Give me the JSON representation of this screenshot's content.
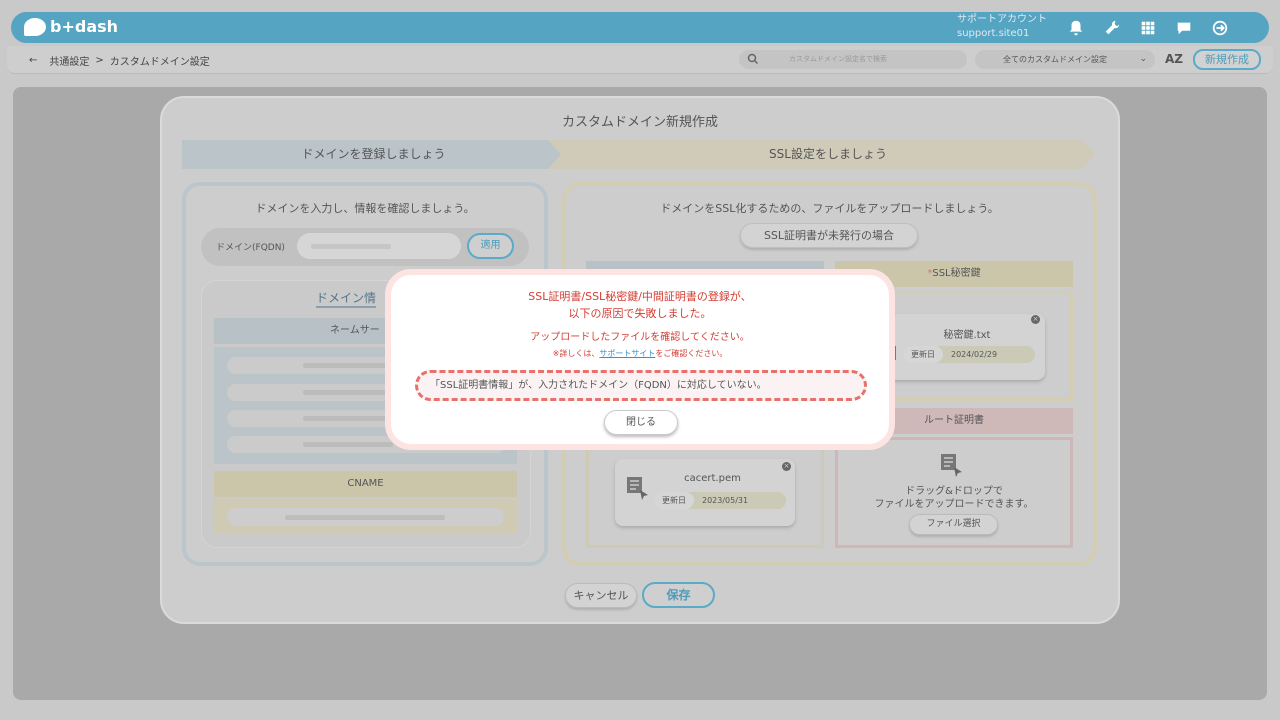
{
  "header": {
    "brand": "b+dash",
    "account_label": "サポートアカウント",
    "account_site": "support.site01",
    "icons": [
      "bell-icon",
      "wrench-icon",
      "grid-icon",
      "chat-icon",
      "logout-icon"
    ]
  },
  "subbar": {
    "back_icon": "back-arrow-icon",
    "breadcrumb_parent": "共通設定",
    "breadcrumb_sep": ">",
    "breadcrumb_current": "カスタムドメイン設定",
    "search_placeholder": "カスタムドメイン設定名で検索",
    "filter_value": "全てのカスタムドメイン設定",
    "sort_label": "AZ",
    "new_button": "新規作成"
  },
  "modal": {
    "title": "カスタムドメイン新規作成",
    "step1": "ドメインを登録しましょう",
    "step2": "SSL設定をしましょう",
    "left": {
      "instruction": "ドメインを入力し、情報を確認しましょう。",
      "fqdn_label": "ドメイン(FQDN)",
      "apply_button": "適用",
      "info_title": "ドメイン情",
      "nameserver_header": "ネームサー",
      "cname_header": "CNAME"
    },
    "right": {
      "instruction": "ドメインをSSL化するための、ファイルをアップロードしましょう。",
      "ssl_unissued_button": "SSL証明書が未発行の場合",
      "key_required_mark": "*",
      "key_header": "SSL秘密鍵",
      "key_file": {
        "name": "秘密鍵.txt",
        "tag": "更新日",
        "date": "2024/02/29"
      },
      "root_header": "ルート証明書",
      "inter_file": {
        "name": "cacert.pem",
        "tag": "更新日",
        "date": "2023/05/31"
      },
      "drop_text_1": "ドラッグ&ドロップで",
      "drop_text_2": "ファイルをアップロードできます。",
      "file_select_button": "ファイル選択"
    },
    "cancel_button": "キャンセル",
    "save_button": "保存"
  },
  "alert": {
    "line1": "SSL証明書/SSL秘密鍵/中間証明書の登録が、",
    "line2": "以下の原因で失敗しました。",
    "line3": "アップロードしたファイルを確認してください。",
    "note_prefix": "※詳しくは、",
    "note_link": "サポートサイト",
    "note_suffix": "をご確認ください。",
    "error_message": "「SSL証明書情報」が、入力されたドメイン（FQDN）に対応していない。",
    "close_button": "閉じる"
  }
}
